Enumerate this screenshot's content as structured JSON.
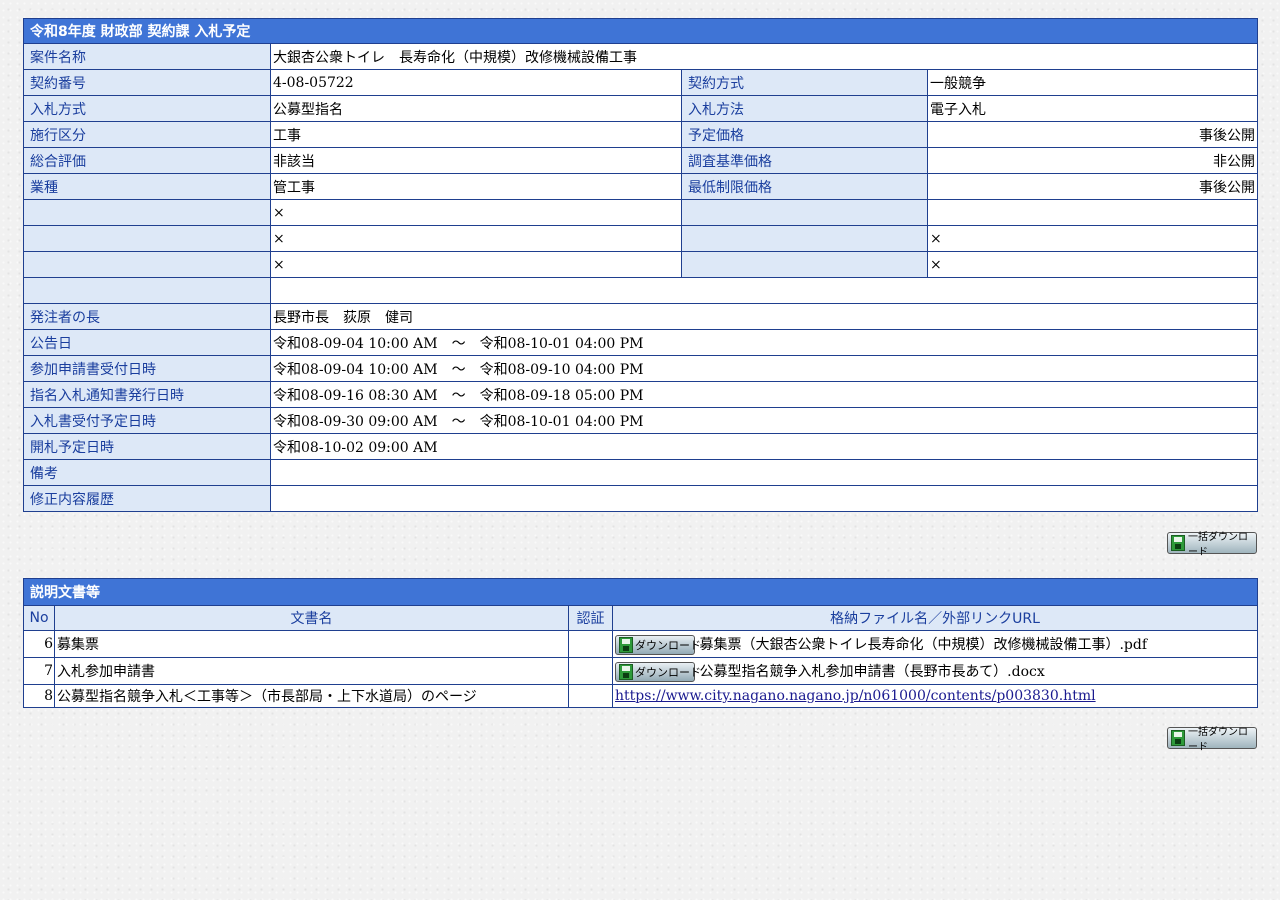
{
  "detail": {
    "title": "令和8年度 財政部 契約課 入札予定",
    "project_name_label": "案件名称",
    "project_name": "大銀杏公衆トイレ　長寿命化（中規模）改修機械設備工事",
    "rows": [
      {
        "l1": "契約番号",
        "v1": "4-08-05722",
        "l2": "契約方式",
        "v2": "一般競争"
      },
      {
        "l1": "入札方式",
        "v1": "公募型指名",
        "l2": "入札方法",
        "v2": "電子入札"
      },
      {
        "l1": "施行区分",
        "v1": "工事",
        "l2": "予定価格",
        "v2": "事後公開"
      },
      {
        "l1": "総合評価",
        "v1": "非該当",
        "l2": "調査基準価格",
        "v2": "非公開"
      },
      {
        "l1": "業種",
        "v1": "管工事",
        "l2": "最低制限価格",
        "v2": "事後公開"
      },
      {
        "l1": "",
        "v1": "×",
        "l2": "",
        "v2": ""
      },
      {
        "l1": "",
        "v1": "×",
        "l2": "",
        "v2": "×"
      },
      {
        "l1": "",
        "v1": "×",
        "l2": "",
        "v2": "×"
      }
    ],
    "full_rows": [
      {
        "label": "",
        "value": ""
      },
      {
        "label": "発注者の長",
        "value": "長野市長　荻原　健司"
      },
      {
        "label": "公告日",
        "value": "令和08-09-04 10:00 AM　～　令和08-10-01 04:00 PM"
      },
      {
        "label": "参加申請書受付日時",
        "value": "令和08-09-04 10:00 AM　～　令和08-09-10 04:00 PM"
      },
      {
        "label": "指名入札通知書発行日時",
        "value": "令和08-09-16 08:30 AM　～　令和08-09-18 05:00 PM"
      },
      {
        "label": "入札書受付予定日時",
        "value": "令和08-09-30 09:00 AM　～　令和08-10-01 04:00 PM"
      },
      {
        "label": "開札予定日時",
        "value": "令和08-10-02 09:00 AM"
      },
      {
        "label": "備考",
        "value": ""
      },
      {
        "label": "修正内容履歴",
        "value": ""
      }
    ]
  },
  "bulk_download_label": "一括ダウンロード",
  "docs": {
    "title": "説明文書等",
    "headers": {
      "no": "No",
      "name": "文書名",
      "auth": "認証",
      "file": "格納ファイル名／外部リンクURL"
    },
    "download_label": "ダウンロード",
    "rows": [
      {
        "no": "6",
        "name": "募集票",
        "auth": "",
        "file": "募集票（大銀杏公衆トイレ長寿命化（中規模）改修機械設備工事）.pdf"
      },
      {
        "no": "7",
        "name": "入札参加申請書",
        "auth": "",
        "file": "公募型指名競争入札参加申請書（長野市長あて）.docx"
      },
      {
        "no": "8",
        "name": "公募型指名競争入札＜工事等＞（市長部局・上下水道局）のページ",
        "auth": "",
        "link": "https://www.city.nagano.nagano.jp/n061000/contents/p003830.html"
      }
    ]
  },
  "colors": {
    "header_bg": "#3f74d6",
    "label_bg": "#dde8f7",
    "label_text": "#1a3e9e",
    "border": "#1f3f8f"
  },
  "icons": {
    "download": "floppy-disk-icon"
  }
}
